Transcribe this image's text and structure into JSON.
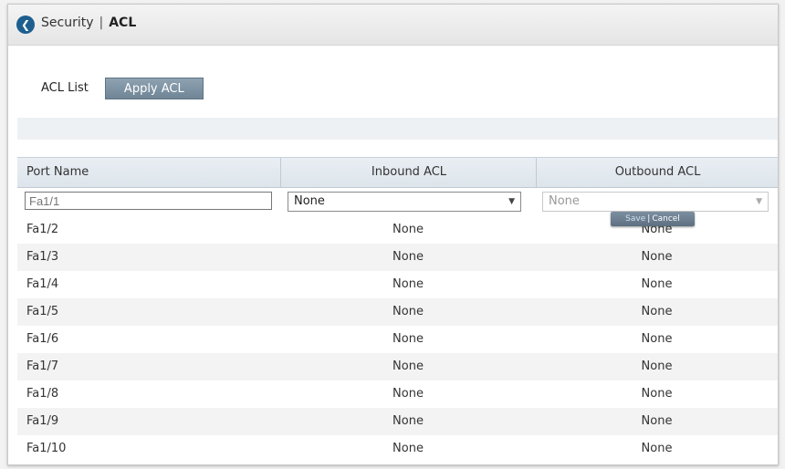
{
  "breadcrumb": {
    "section": "Security",
    "separator": "|",
    "current": "ACL"
  },
  "tabs": [
    {
      "label": "ACL List"
    },
    {
      "label": "Apply ACL",
      "active": true
    }
  ],
  "table": {
    "columns": [
      "Port Name",
      "Inbound ACL",
      "Outbound ACL"
    ],
    "edit_row": {
      "port_placeholder": "Fa1/1",
      "inbound_value": "None",
      "outbound_value": "None"
    },
    "rows": [
      {
        "port": "Fa1/2",
        "inbound": "None",
        "outbound": "None"
      },
      {
        "port": "Fa1/3",
        "inbound": "None",
        "outbound": "None"
      },
      {
        "port": "Fa1/4",
        "inbound": "None",
        "outbound": "None"
      },
      {
        "port": "Fa1/5",
        "inbound": "None",
        "outbound": "None"
      },
      {
        "port": "Fa1/6",
        "inbound": "None",
        "outbound": "None"
      },
      {
        "port": "Fa1/7",
        "inbound": "None",
        "outbound": "None"
      },
      {
        "port": "Fa1/8",
        "inbound": "None",
        "outbound": "None"
      },
      {
        "port": "Fa1/9",
        "inbound": "None",
        "outbound": "None"
      },
      {
        "port": "Fa1/10",
        "inbound": "None",
        "outbound": "None"
      }
    ]
  },
  "actions": {
    "save": "Save",
    "separator": "|",
    "cancel": "Cancel"
  },
  "icons": {
    "back": "back-arrow-icon",
    "dropdown": "chevron-down-icon"
  },
  "colors": {
    "accent": "#1d5f8f",
    "active_tab": "#7a8fa0",
    "header_bg": "#e5e5e5"
  }
}
